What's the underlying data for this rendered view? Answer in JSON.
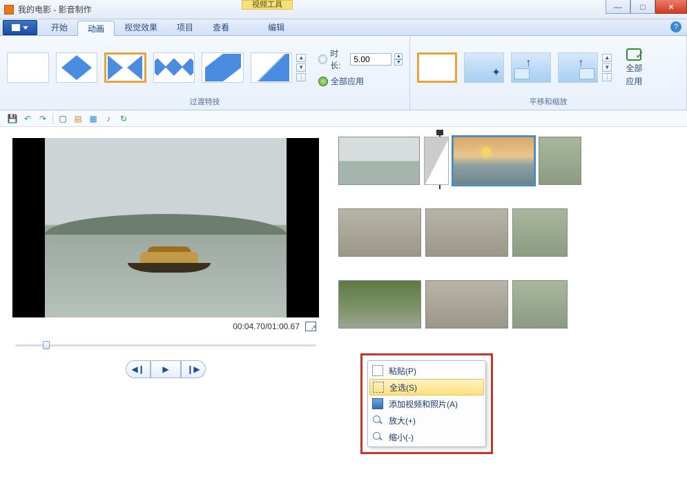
{
  "titlebar": {
    "title": "我的电影 - 影音制作",
    "tool_tab": "视频工具"
  },
  "winbtns": {
    "min": "—",
    "max": "□",
    "close": "×"
  },
  "tabs": {
    "start": "开始",
    "animation": "动画",
    "visual": "视觉效果",
    "project": "项目",
    "view": "查看",
    "edit": "编辑"
  },
  "ribbon": {
    "transitions_label": "过渡特技",
    "duration_label": "时长:",
    "duration_value": "5.00",
    "apply_all": "全部应用",
    "panzoom_label": "平移和缩放",
    "apply_all_btn_line1": "全部",
    "apply_all_btn_line2": "应用"
  },
  "player": {
    "time": "00:04.70/01:00.67"
  },
  "context_menu": {
    "paste": "粘贴(P)",
    "select_all": "全选(S)",
    "add_media": "添加视频和照片(A)",
    "zoom_in": "放大(+)",
    "zoom_out": "缩小(-)"
  },
  "icons": {
    "help": "?",
    "spin_up": "▲",
    "spin_dn": "▼",
    "spin_more": "⋮",
    "prev": "◀❙",
    "play": "▶",
    "next": "❙▶",
    "save": "💾",
    "undo": "↶",
    "redo": "↷",
    "new": "▢",
    "q1": "▤",
    "q2": "▦",
    "music": "♪",
    "refresh": "↻",
    "arrow_up": "↑"
  }
}
